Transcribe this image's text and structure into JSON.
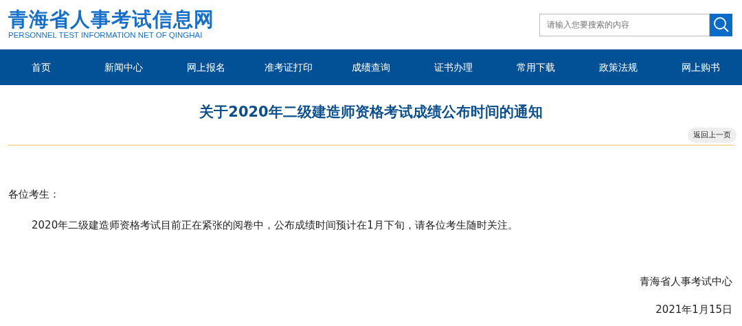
{
  "header": {
    "logo_title": "青海省人事考试信息网",
    "logo_subtitle": "PERSONNEL TEST INFORMATION NET OF QINGHAI",
    "search": {
      "placeholder": "请输入您要搜索的内容"
    }
  },
  "nav": [
    "首页",
    "新闻中心",
    "网上报名",
    "准考证打印",
    "成绩查询",
    "证书办理",
    "常用下载",
    "政策法规",
    "网上购书"
  ],
  "article": {
    "title": "关于2020年二级建造师资格考试成绩公布时间的通知",
    "back_button": "返回上一页",
    "greeting": "各位考生：",
    "body": "2020年二级建造师资格考试目前正在紧张的阅卷中，公布成绩时间预计在1月下旬，请各位考生随时关注。",
    "signature": "青海省人事考试中心",
    "date": "2021年1月15日"
  }
}
